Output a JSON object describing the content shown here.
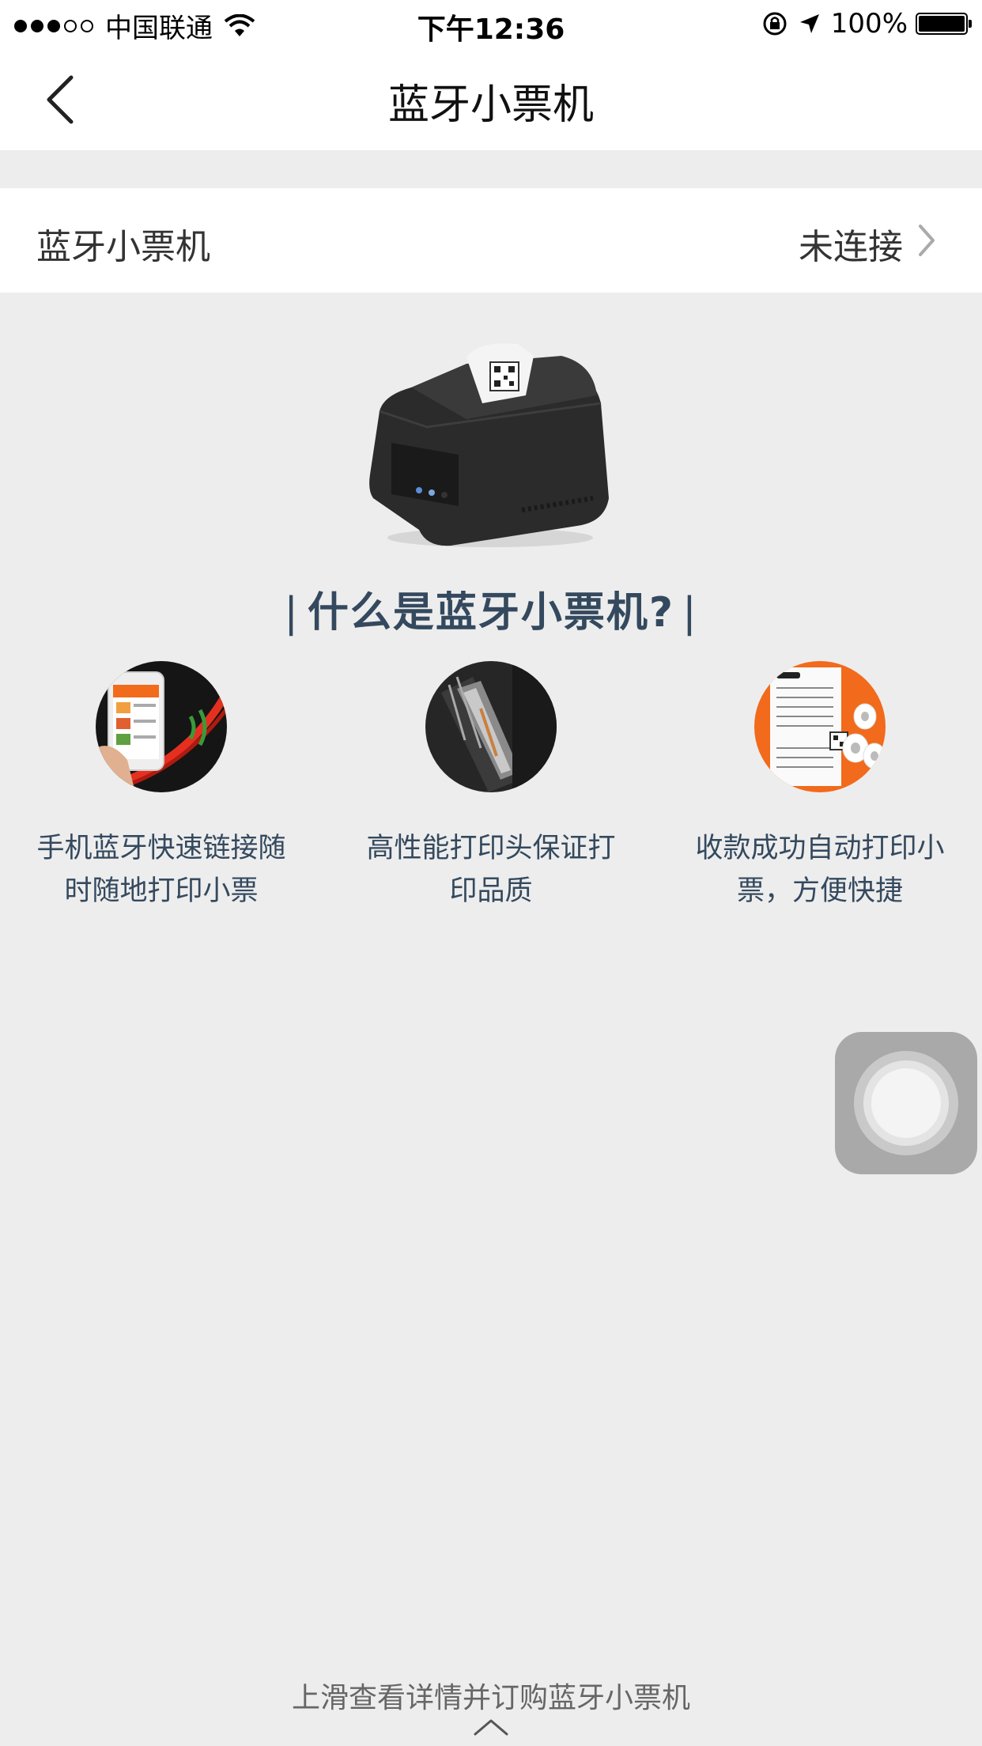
{
  "status_bar": {
    "carrier": "中国联通",
    "time": "下午12:36",
    "battery": "100%",
    "signal_dots_filled": 3,
    "signal_dots_total": 5
  },
  "navbar": {
    "title": "蓝牙小票机",
    "back_icon": "chevron-left-icon"
  },
  "printer_row": {
    "label": "蓝牙小票机",
    "status": "未连接",
    "chevron_icon": "chevron-right-icon"
  },
  "intro": {
    "heading": "什么是蓝牙小票机?",
    "heading_bar": "|",
    "features": [
      {
        "text_line1": "手机蓝牙快速链接随",
        "text_line2": "时随地打印小票",
        "image": "phone-bluetooth-image"
      },
      {
        "text_line1": "高性能打印头保证打",
        "text_line2": "印品质",
        "image": "print-head-image"
      },
      {
        "text_line1": "收款成功自动打印小",
        "text_line2": "票，方便快捷",
        "image": "receipt-rolls-image"
      }
    ]
  },
  "footer": {
    "hint": "上滑查看详情并订购蓝牙小票机",
    "arrow_icon": "chevron-up-icon"
  },
  "colors": {
    "background": "#ededed",
    "heading": "#34495e",
    "accent_orange": "#f26a1b"
  }
}
